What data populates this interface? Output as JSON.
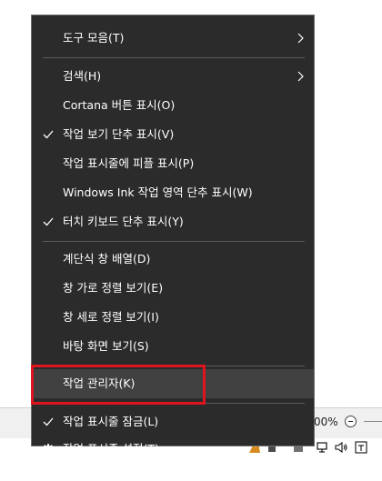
{
  "menu": {
    "items": [
      {
        "label": "도구 모음(T)"
      },
      {
        "label": "검색(H)"
      },
      {
        "label": "Cortana 버튼 표시(O)"
      },
      {
        "label": "작업 보기 단추 표시(V)"
      },
      {
        "label": "작업 표시줄에 피플 표시(P)"
      },
      {
        "label": "Windows Ink 작업 영역 단추 표시(W)"
      },
      {
        "label": "터치 키보드 단추 표시(Y)"
      },
      {
        "label": "계단식 창 배열(D)"
      },
      {
        "label": "창 가로 정렬 보기(E)"
      },
      {
        "label": "창 세로 정렬 보기(I)"
      },
      {
        "label": "바탕 화면 보기(S)"
      },
      {
        "label": "작업 관리자(K)"
      },
      {
        "label": "작업 표시줄 잠금(L)"
      },
      {
        "label": "작업 표시줄 설정(T)"
      }
    ]
  },
  "background": {
    "zoom_text": "00%"
  },
  "colors": {
    "menu_bg": "#2b2b2b",
    "menu_hover": "#414141",
    "highlight_border": "#e0141e"
  }
}
